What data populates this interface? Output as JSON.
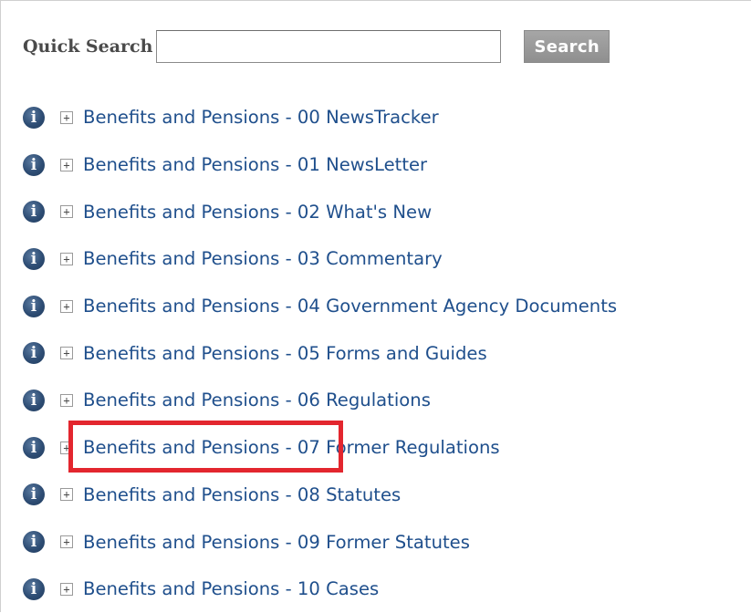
{
  "search": {
    "label": "Quick Search",
    "input_value": "",
    "button_label": "Search"
  },
  "icons": {
    "info": "info-icon",
    "expand": "plus-box-icon",
    "info_glyph": "i",
    "expand_glyph": "+"
  },
  "items": [
    {
      "label": "Benefits and Pensions - 00 NewsTracker"
    },
    {
      "label": "Benefits and Pensions - 01 NewsLetter"
    },
    {
      "label": "Benefits and Pensions - 02 What's New"
    },
    {
      "label": "Benefits and Pensions - 03 Commentary"
    },
    {
      "label": "Benefits and Pensions - 04 Government Agency Documents"
    },
    {
      "label": "Benefits and Pensions - 05 Forms and Guides"
    },
    {
      "label": "Benefits and Pensions - 06 Regulations"
    },
    {
      "label": "Benefits and Pensions - 07 Former Regulations"
    },
    {
      "label": "Benefits and Pensions - 08 Statutes"
    },
    {
      "label": "Benefits and Pensions - 09 Former Statutes"
    },
    {
      "label": "Benefits and Pensions - 10 Cases"
    }
  ],
  "colors": {
    "link": "#1f4f8c",
    "info_icon": "#2e4d74",
    "highlight_box": "#e3262e",
    "search_button": "#9b9b9b"
  }
}
